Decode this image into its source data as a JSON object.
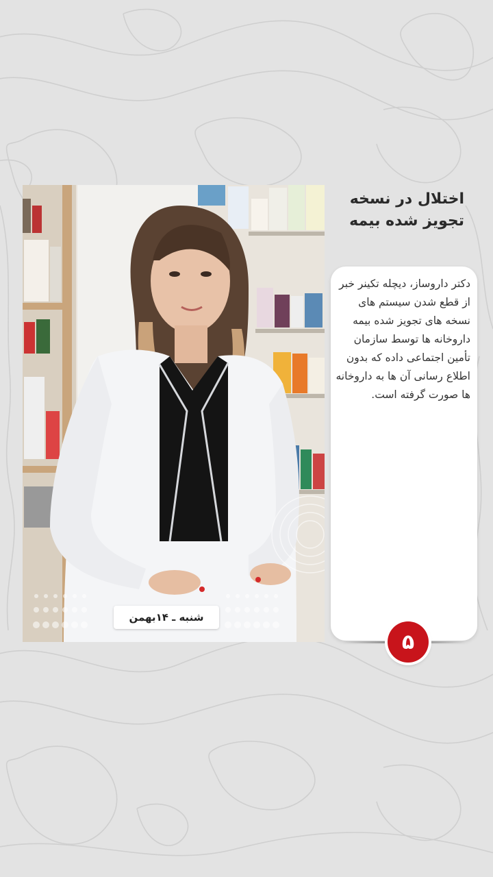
{
  "post": {
    "title": "اختلال در نسخه تجویز شده بیمه",
    "body": "دکتر داروساز، دیچله تکینر خبر از قطع شدن سیستم های نسخه های تجویز شده بیمه داروخانه ها توسط سازمان تأمین اجتماعی داده که بدون اطلاع رسانی آن ها به داروخانه ها صورت گرفته است.",
    "date": "شنبه ـ ۱۴بهمن",
    "page_number": "۵"
  },
  "colors": {
    "background": "#e3e3e3",
    "accent": "#c8141b",
    "card": "#ffffff"
  }
}
